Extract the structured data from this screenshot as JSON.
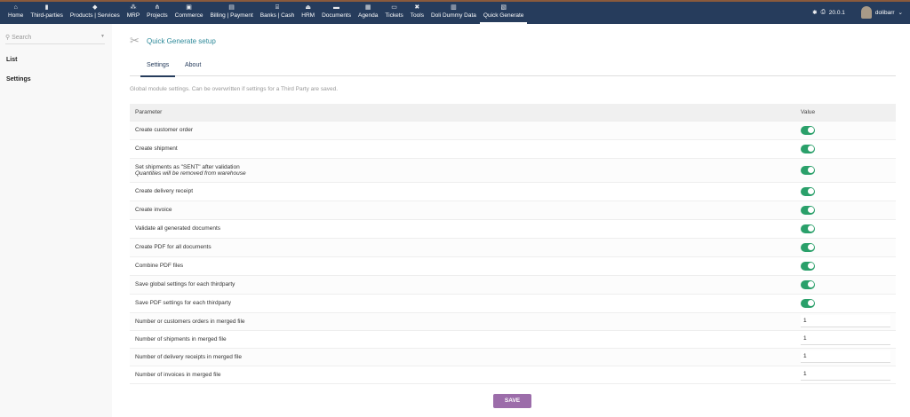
{
  "topbar": {
    "menu": [
      {
        "label": "Home",
        "icon": "home-icon",
        "glyph": "⌂"
      },
      {
        "label": "Third-parties",
        "icon": "building-icon",
        "glyph": "▮"
      },
      {
        "label": "Products | Services",
        "icon": "cube-icon",
        "glyph": "◆"
      },
      {
        "label": "MRP",
        "icon": "cubes-icon",
        "glyph": "⁂"
      },
      {
        "label": "Projects",
        "icon": "sitemap-icon",
        "glyph": "⋔"
      },
      {
        "label": "Commerce",
        "icon": "suitcase-icon",
        "glyph": "▣"
      },
      {
        "label": "Billing | Payment",
        "icon": "file-invoice-icon",
        "glyph": "▤"
      },
      {
        "label": "Banks | Cash",
        "icon": "bank-icon",
        "glyph": "⌸"
      },
      {
        "label": "HRM",
        "icon": "user-tie-icon",
        "glyph": "⏏"
      },
      {
        "label": "Documents",
        "icon": "folder-icon",
        "glyph": "▬"
      },
      {
        "label": "Agenda",
        "icon": "calendar-icon",
        "glyph": "▦"
      },
      {
        "label": "Tickets",
        "icon": "ticket-icon",
        "glyph": "▭"
      },
      {
        "label": "Tools",
        "icon": "tools-icon",
        "glyph": "✖"
      },
      {
        "label": "Doli Dummy Data",
        "icon": "database-icon",
        "glyph": "▥"
      },
      {
        "label": "Quick Generate",
        "icon": "quick-generate-icon",
        "glyph": "▧"
      }
    ],
    "version": "20.0.1",
    "user": "dolibarr"
  },
  "sidebar": {
    "search_placeholder": "Search",
    "items": [
      {
        "label": "List"
      },
      {
        "label": "Settings"
      }
    ]
  },
  "page": {
    "title": "Quick Generate setup",
    "tabs": [
      {
        "label": "Settings"
      },
      {
        "label": "About"
      }
    ],
    "note": "Global module settings. Can be overwritten if settings for a Third Party are saved.",
    "col_param": "Parameter",
    "col_value": "Value",
    "toggles": [
      {
        "label": "Create customer order",
        "on": true
      },
      {
        "label": "Create shipment",
        "on": true
      },
      {
        "label": "Set shipments as \"SENT\" after validation",
        "sub": "Quantities will be removed from warehouse",
        "on": true
      },
      {
        "label": "Create delivery receipt",
        "on": true
      },
      {
        "label": "Create invoice",
        "on": true
      },
      {
        "label": "Validate all generated documents",
        "on": true
      },
      {
        "label": "Create PDF for all documents",
        "on": true
      },
      {
        "label": "Combine PDF files",
        "on": true
      },
      {
        "label": "Save global settings for each thirdparty",
        "on": true
      },
      {
        "label": "Save PDF settings for each thirdparty",
        "on": true
      }
    ],
    "numbers": [
      {
        "label": "Number or customers orders in merged file",
        "value": "1"
      },
      {
        "label": "Number of shipments in merged file",
        "value": "1"
      },
      {
        "label": "Number of delivery receipts in merged file",
        "value": "1"
      },
      {
        "label": "Number of invoices in merged file",
        "value": "1"
      }
    ],
    "save_label": "SAVE"
  }
}
